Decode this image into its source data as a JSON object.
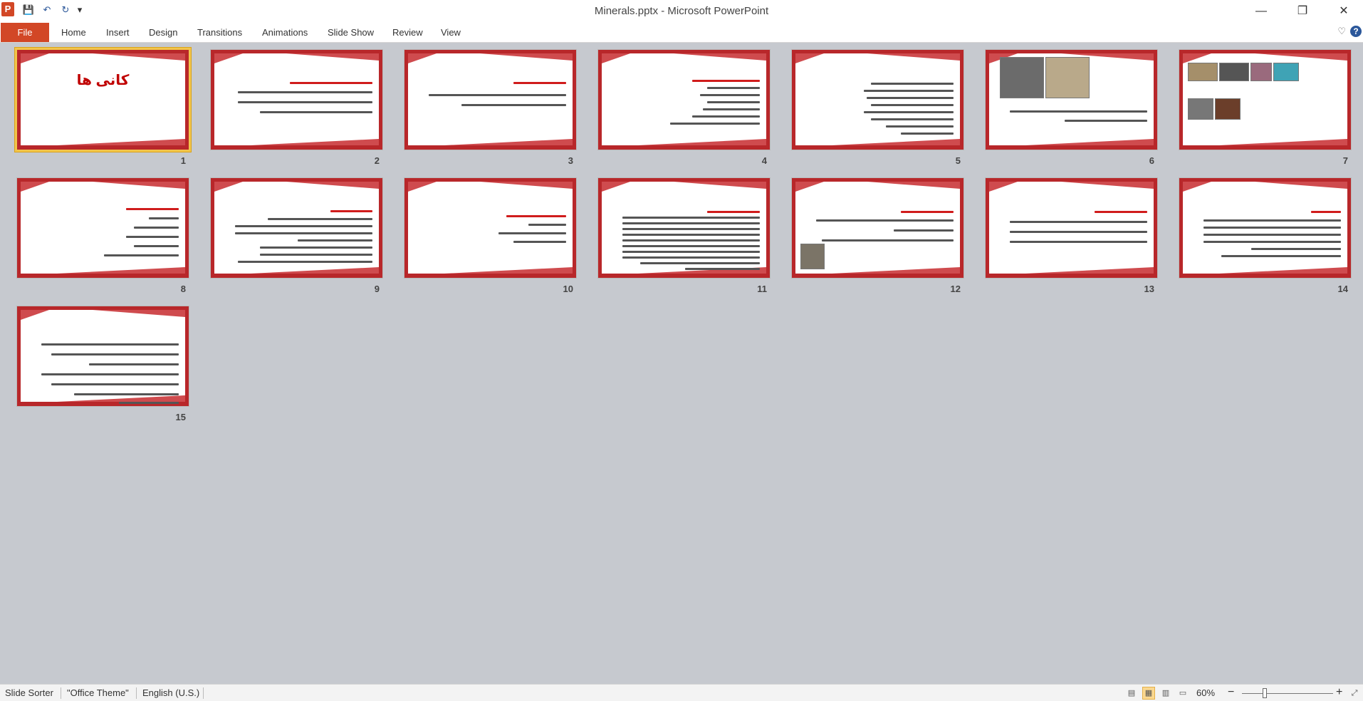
{
  "window": {
    "title": "Minerals.pptx  -  Microsoft PowerPoint",
    "app_icon": "P",
    "minimize_icon": "—",
    "maximize_icon": "❐",
    "close_icon": "✕"
  },
  "qat": {
    "save_icon": "💾",
    "undo_icon": "↶",
    "redo_icon": "↻",
    "customize_icon": "▾"
  },
  "ribbon": {
    "file": "File",
    "tabs": [
      "Home",
      "Insert",
      "Design",
      "Transitions",
      "Animations",
      "Slide Show",
      "Review",
      "View"
    ],
    "collapse_icon": "♡",
    "help_icon": "?"
  },
  "slides": [
    {
      "num": "1",
      "title": "کانی ها",
      "selected": true
    },
    {
      "num": "2"
    },
    {
      "num": "3"
    },
    {
      "num": "4"
    },
    {
      "num": "5"
    },
    {
      "num": "6"
    },
    {
      "num": "7"
    },
    {
      "num": "8"
    },
    {
      "num": "9"
    },
    {
      "num": "10"
    },
    {
      "num": "11"
    },
    {
      "num": "12"
    },
    {
      "num": "13"
    },
    {
      "num": "14"
    },
    {
      "num": "15"
    }
  ],
  "status": {
    "view": "Slide Sorter",
    "theme": "\"Office Theme\"",
    "language": "English (U.S.)",
    "zoom": "60%",
    "zoom_out": "−",
    "zoom_in": "+"
  }
}
